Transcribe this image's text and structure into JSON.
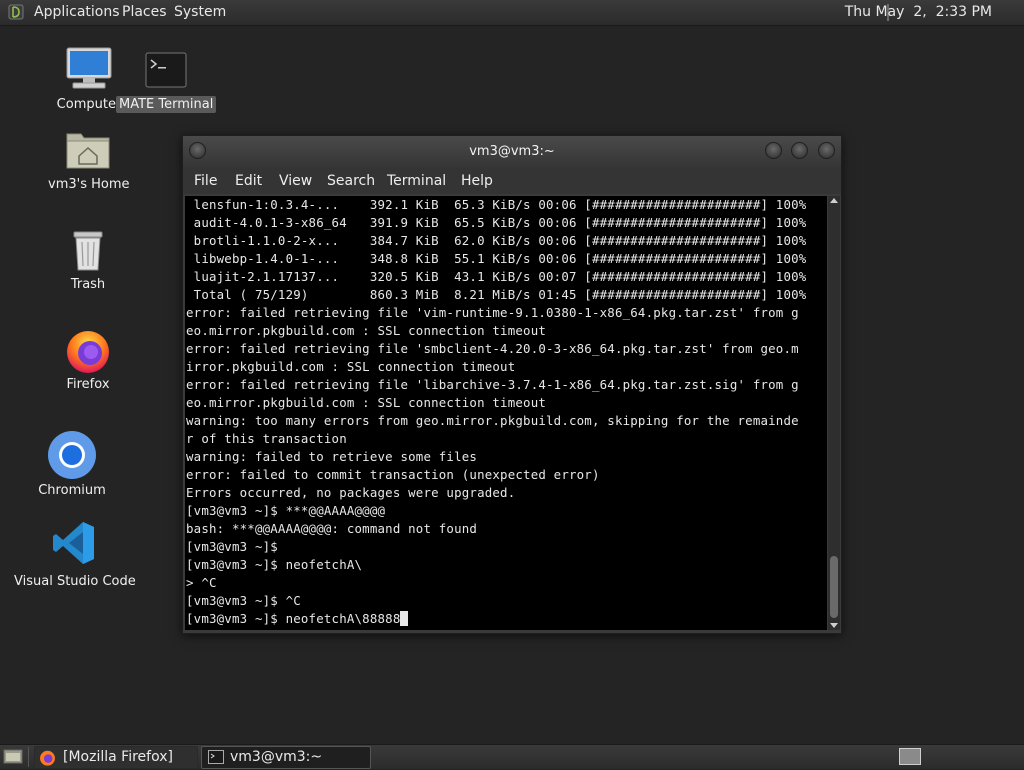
{
  "top_panel": {
    "menus": [
      "Applications",
      "Places",
      "System"
    ],
    "clock": "Thu May  2,  2:33 PM"
  },
  "desktop": {
    "icons": [
      {
        "label": "Computer",
        "icon": "computer-icon"
      },
      {
        "label": "MATE Terminal",
        "icon": "terminal-icon"
      },
      {
        "label": "vm3's Home",
        "icon": "home-folder-icon"
      },
      {
        "label": "Trash",
        "icon": "trash-icon"
      },
      {
        "label": "Firefox",
        "icon": "firefox-icon"
      },
      {
        "label": "Chromium",
        "icon": "chromium-icon"
      },
      {
        "label": "Visual Studio Code",
        "icon": "vscode-icon"
      }
    ]
  },
  "window": {
    "title": "vm3@vm3:~",
    "menu": [
      "File",
      "Edit",
      "View",
      "Search",
      "Terminal",
      "Help"
    ],
    "terminal_lines": [
      " lensfun-1:0.3.4-...    392.1 KiB  65.3 KiB/s 00:06 [######################] 100%",
      " audit-4.0.1-3-x86_64   391.9 KiB  65.5 KiB/s 00:06 [######################] 100%",
      " brotli-1.1.0-2-x...    384.7 KiB  62.0 KiB/s 00:06 [######################] 100%",
      " libwebp-1.4.0-1-...    348.8 KiB  55.1 KiB/s 00:06 [######################] 100%",
      " luajit-2.1.17137...    320.5 KiB  43.1 KiB/s 00:07 [######################] 100%",
      " Total ( 75/129)        860.3 MiB  8.21 MiB/s 01:45 [######################] 100%",
      "error: failed retrieving file 'vim-runtime-9.1.0380-1-x86_64.pkg.tar.zst' from g",
      "eo.mirror.pkgbuild.com : SSL connection timeout",
      "error: failed retrieving file 'smbclient-4.20.0-3-x86_64.pkg.tar.zst' from geo.m",
      "irror.pkgbuild.com : SSL connection timeout",
      "error: failed retrieving file 'libarchive-3.7.4-1-x86_64.pkg.tar.zst.sig' from g",
      "eo.mirror.pkgbuild.com : SSL connection timeout",
      "warning: too many errors from geo.mirror.pkgbuild.com, skipping for the remainde",
      "r of this transaction",
      "warning: failed to retrieve some files",
      "error: failed to commit transaction (unexpected error)",
      "Errors occurred, no packages were upgraded.",
      "[vm3@vm3 ~]$ ***@@AAAA@@@@",
      "bash: ***@@AAAA@@@@: command not found",
      "[vm3@vm3 ~]$",
      "[vm3@vm3 ~]$ neofetchA\\",
      "> ^C",
      "[vm3@vm3 ~]$ ^C",
      "[vm3@vm3 ~]$ neofetchA\\88888"
    ]
  },
  "taskbar": {
    "tasks": [
      {
        "label": "[Mozilla Firefox]",
        "icon": "firefox-icon"
      },
      {
        "label": "vm3@vm3:~",
        "icon": "terminal-icon"
      }
    ]
  },
  "colors": {
    "desktop_bg": "#242424",
    "terminal_bg": "#000000",
    "terminal_fg": "#e8e8e8",
    "panel_bg": "#2f2f2f"
  }
}
